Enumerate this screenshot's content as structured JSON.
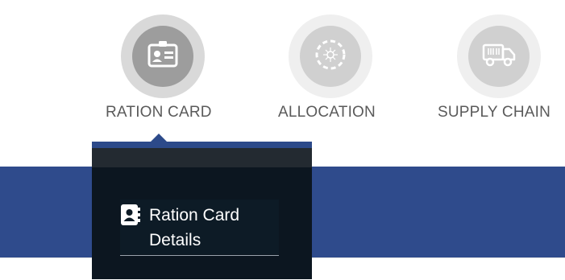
{
  "nav": {
    "items": [
      {
        "label": "RATION CARD",
        "icon": "id-badge-icon",
        "active": true
      },
      {
        "label": "ALLOCATION",
        "icon": "allocation-wheel-icon",
        "active": false
      },
      {
        "label": "SUPPLY CHAIN",
        "icon": "delivery-truck-icon",
        "active": false
      }
    ]
  },
  "dropdown": {
    "items": [
      {
        "label_line1": "Ration Card",
        "label_line2": "Details",
        "icon": "contact-book-icon"
      }
    ]
  },
  "colors": {
    "active_ring": "#dcdcdc",
    "active_fill": "#9e9e9e",
    "inactive_ring": "#eeeeee",
    "inactive_fill": "#cfcfcf",
    "band": "#2f4b8c",
    "dropdown_bg": "#0c1620"
  }
}
